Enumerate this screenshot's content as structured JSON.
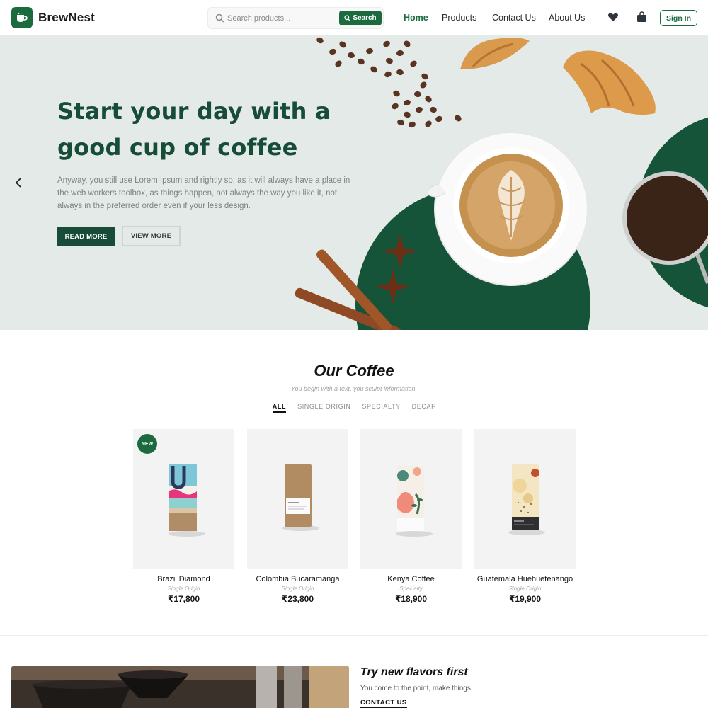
{
  "brand": {
    "name": "BrewNest",
    "accent": "#1b6b3f",
    "hero_green": "#174d38"
  },
  "search": {
    "placeholder": "Search products...",
    "button_label": "Search"
  },
  "nav": [
    {
      "label": "Home",
      "active": true
    },
    {
      "label": "Products",
      "active": false
    },
    {
      "label": "Contact Us",
      "active": false
    },
    {
      "label": "About Us",
      "active": false
    }
  ],
  "header_icons": [
    "heart-icon",
    "shopping-bag-icon"
  ],
  "signin_label": "Sign In",
  "hero": {
    "title": "Start your day with a good cup of coffee",
    "text": "Anyway, you still use Lorem Ipsum and rightly so, as it will always have a place in the web workers toolbox, as things happen, not always the way you like it, not always in the preferred order even if your less design.",
    "read_more": "READ MORE",
    "view_more": "VIEW MORE",
    "prev_icon": "chevron-left-icon"
  },
  "coffee": {
    "title": "Our Coffee",
    "subtitle": "You begin with a text, you sculpt information.",
    "filters": [
      {
        "label": "ALL",
        "active": true
      },
      {
        "label": "SINGLE ORIGIN",
        "active": false
      },
      {
        "label": "SPECIALTY",
        "active": false
      },
      {
        "label": "DECAF",
        "active": false
      }
    ],
    "products": [
      {
        "name": "Brazil Diamond",
        "category": "Single Origin",
        "price": "₹17,800",
        "badge": "NEW"
      },
      {
        "name": "Colombia Bucaramanga",
        "category": "Single Origin",
        "price": "₹23,800"
      },
      {
        "name": "Kenya Coffee",
        "category": "Specialty",
        "price": "₹18,900"
      },
      {
        "name": "Guatemala Huehuetenango",
        "category": "Single Origin",
        "price": "₹19,900"
      }
    ]
  },
  "promo": {
    "title": "Try new flavors first",
    "text": "You come to the point, make things.",
    "link": "CONTACT US"
  }
}
